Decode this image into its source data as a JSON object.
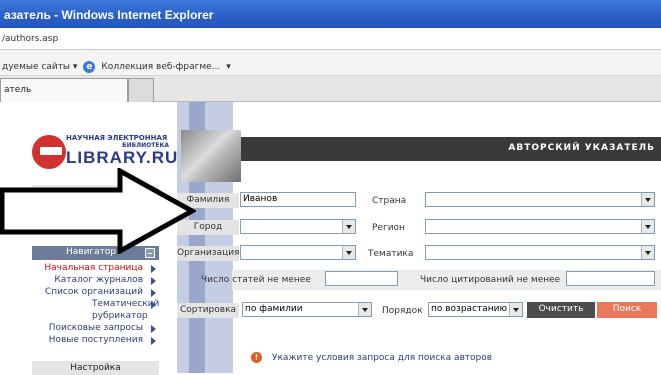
{
  "browser": {
    "title": "азатель - Windows Internet Explorer",
    "address": "/authors.asp",
    "favorites": [
      "дуемые сайты ▾",
      "Коллекция веб-фрагме...",
      "▾"
    ],
    "tab_label": "атель"
  },
  "logo": {
    "line1": "НАУЧНАЯ ЭЛЕКТРОННАЯ",
    "line2": "БИБЛИОТЕКА",
    "brand": "LIBRARY.RU"
  },
  "banner": {
    "title": "АВТОРСКИЙ УКАЗАТЕЛЬ"
  },
  "form": {
    "surname_label": "Фамилия",
    "surname_value": "Иванов",
    "country_label": "Страна",
    "city_label": "Город",
    "region_label": "Регион",
    "org_label": "Организация",
    "topic_label": "Тематика",
    "articles_label": "Число статей не менее",
    "citations_label": "Число цитирований не менее",
    "sort_label": "Сортировка",
    "sort_value": "по фамилии",
    "order_label": "Порядок",
    "order_value": "по возрастанию",
    "clear_button": "Очистить",
    "search_button": "Поиск"
  },
  "navigator": {
    "title": "Навигатор",
    "items": [
      {
        "label": "Начальная страница",
        "active": true
      },
      {
        "label": "Каталог журналов",
        "active": false
      },
      {
        "label": "Список организаций",
        "active": false
      },
      {
        "label": "Тематический рубрикатор",
        "active": false
      },
      {
        "label": "Поисковые запросы",
        "active": false
      },
      {
        "label": "Новые поступления",
        "active": false
      }
    ],
    "settings": "Настройка"
  },
  "message": "Укажите условия запроса для поиска авторов"
}
